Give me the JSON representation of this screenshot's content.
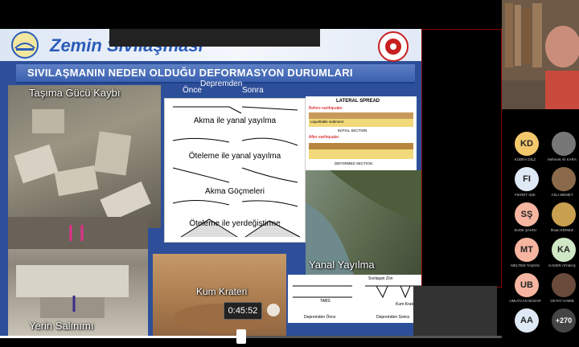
{
  "slide": {
    "title": "Zemin Sıvılaşması",
    "heading": "SIVILAŞMANIN NEDEN OLDUĞU DEFORMASYON DURUMLARI",
    "panels": {
      "bearing_loss": "Taşıma Gücü Kaybı",
      "ground_settlement": "Yerin Salınımı",
      "sand_crater": "Kum Krateri",
      "lateral_spread_photo": "Yanal Yayılma"
    },
    "diagram": {
      "before": "Önce",
      "after_top": "Depremden",
      "after": "Sonra",
      "items": [
        "Akma ile yanal yayılma",
        "Öteleme ile yanal yayılma",
        "Akma Göçmeleri",
        "Öteleme ile yerdeğiştirme"
      ]
    },
    "spread_diagram": {
      "title": "LATERAL SPREAD",
      "before": "Before earthquake:",
      "initial": "INITIAL SECTION",
      "after": "After earthquake:",
      "deformed": "DEFORMED SECTION",
      "layer": "Liquefiable sediment"
    },
    "bottom_diagram": {
      "before": "Depremden Önce",
      "after": "Depremden Sonra",
      "zone": "Sıvılaşan Zon",
      "crater": "Kum Krateri",
      "tabs": "TABS"
    }
  },
  "player": {
    "timestamp": "0:45:52",
    "progress": 0.48
  },
  "participants": [
    {
      "initials": "KD",
      "name": "KÜBRA DİLZ",
      "color": "#f3c86c"
    },
    {
      "initials": "",
      "name": "Mehmet Ali KARA",
      "color": "#777777"
    },
    {
      "initials": "FI",
      "name": "FIKRET IŞIK",
      "color": "#dfe8f5"
    },
    {
      "initials": "",
      "name": "ASLI MEMET",
      "color": "#8a6a4a"
    },
    {
      "initials": "SŞ",
      "name": "SUDE ŞAHİN",
      "color": "#f6b5a0"
    },
    {
      "initials": "",
      "name": "İhsan KİRMIZI",
      "color": "#c9a050"
    },
    {
      "initials": "MT",
      "name": "MELTEM TAŞKIN",
      "color": "#f6b5a0"
    },
    {
      "initials": "KA",
      "name": "KADER ATABAŞ",
      "color": "#cfe7c4"
    },
    {
      "initials": "UB",
      "name": "UMUTCAN BOZAR",
      "color": "#f6b5a0"
    },
    {
      "initials": "",
      "name": "OKTAY HABİB",
      "color": "#6a4a3a"
    },
    {
      "initials": "AA",
      "name": "",
      "color": "#dfe8f5"
    },
    {
      "initials": "+270",
      "name": "",
      "color": "#444444"
    }
  ]
}
